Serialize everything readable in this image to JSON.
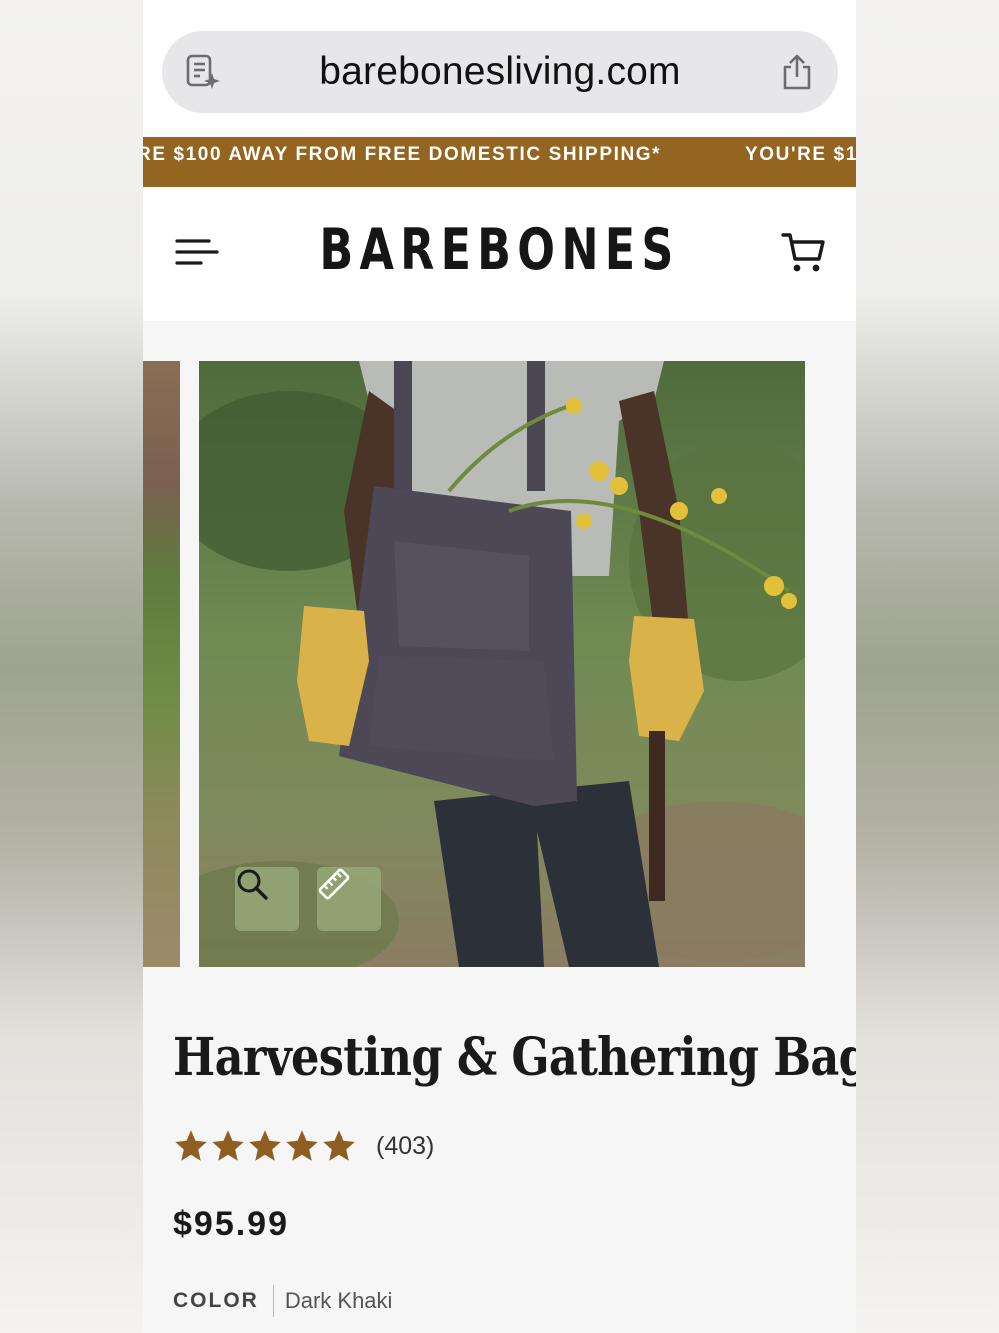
{
  "browser": {
    "url": "barebonesliving.com",
    "reader_icon": "reader-mode-icon",
    "share_icon": "share-icon"
  },
  "promo": {
    "text_1": "RE $100 AWAY FROM FREE DOMESTIC SHIPPING*",
    "text_2": "YOU'RE $1"
  },
  "header": {
    "logo": "BAREBONES",
    "menu_icon": "hamburger-menu-icon",
    "cart_icon": "cart-icon"
  },
  "gallery": {
    "zoom_icon": "magnifier-icon",
    "size_icon": "ruler-icon"
  },
  "product": {
    "title": "Harvesting & Gathering Bag",
    "rating": 5,
    "rating_max": 5,
    "review_count": "(403)",
    "price": "$95.99",
    "color_label": "COLOR",
    "color_value": "Dark Khaki"
  },
  "colors": {
    "brand_brown": "#946421",
    "star_color": "#8f5f22",
    "button_bg": "#96a878"
  }
}
